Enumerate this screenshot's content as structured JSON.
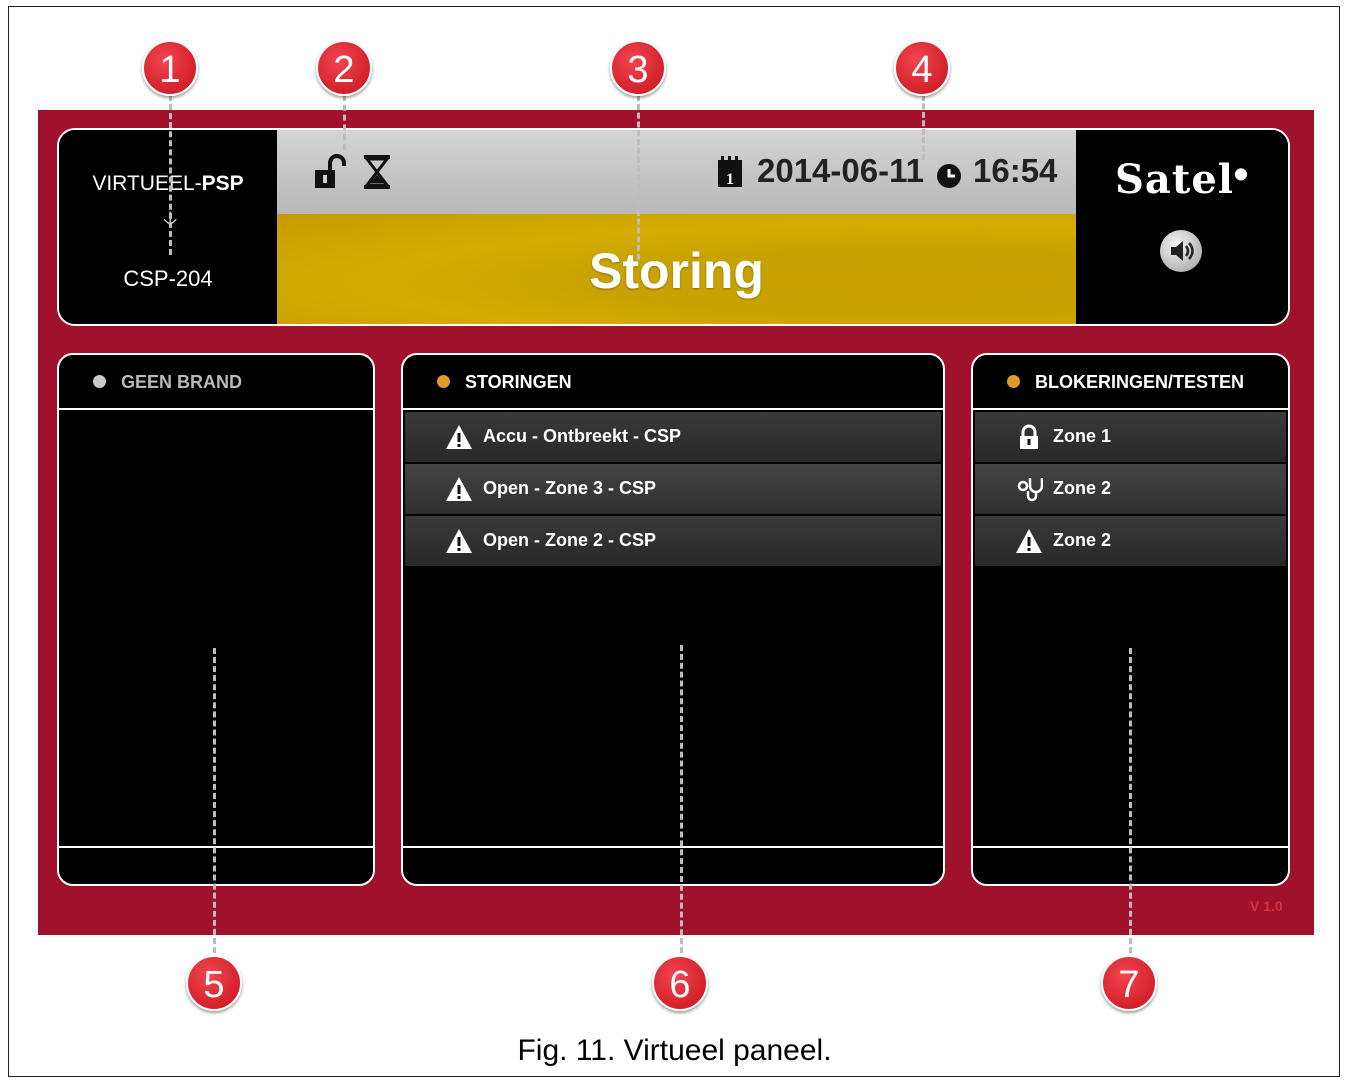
{
  "header": {
    "source": {
      "prefix": "VIRTUEEL-",
      "bold": "PSP"
    },
    "target": "CSP-204",
    "date": "2014-06-11",
    "time": "16:54",
    "status": "Storing",
    "brand": "Satel",
    "icons": [
      "unlock-icon",
      "hourglass-icon",
      "calendar-icon",
      "clock-icon",
      "speaker-icon"
    ]
  },
  "columns": {
    "fire": {
      "title": "GEEN BRAND",
      "dot_color": "#c9c9c9",
      "title_color": "#b9b9b9",
      "rows": []
    },
    "troubles": {
      "title": "STORINGEN",
      "dot_color": "#e09a2a",
      "rows": [
        {
          "icon": "warning-icon",
          "text": "Accu - Ontbreekt - CSP"
        },
        {
          "icon": "warning-icon",
          "text": "Open - Zone 3 - CSP"
        },
        {
          "icon": "warning-icon",
          "text": "Open - Zone 2 - CSP"
        }
      ]
    },
    "blocks": {
      "title": "BLOKERINGEN/TESTEN",
      "dot_color": "#e09a2a",
      "rows": [
        {
          "icon": "lock-icon",
          "text": "Zone 1"
        },
        {
          "icon": "stethoscope-icon",
          "text": "Zone 2"
        },
        {
          "icon": "warning-icon",
          "text": "Zone 2"
        }
      ]
    }
  },
  "version": "V 1.0",
  "callouts": [
    "1",
    "2",
    "3",
    "4",
    "5",
    "6",
    "7"
  ],
  "caption": "Fig. 11. Virtueel paneel.",
  "colors": {
    "panel_bg": "#a0112b",
    "status_bg": "#c9a100",
    "accent_dot": "#e09a2a"
  }
}
